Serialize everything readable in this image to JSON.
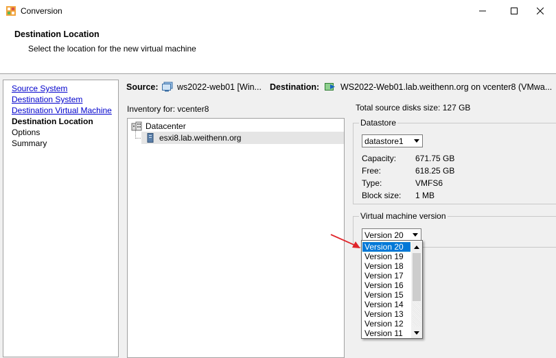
{
  "window": {
    "title": "Conversion",
    "controls": {
      "minimize": "—",
      "maximize": "□",
      "close": "✕"
    }
  },
  "header": {
    "title": "Destination Location",
    "subtitle": "Select the location for the new virtual machine"
  },
  "nav": {
    "items": [
      {
        "label": "Source System",
        "state": "link"
      },
      {
        "label": "Destination System",
        "state": "link"
      },
      {
        "label": "Destination Virtual Machine",
        "state": "link"
      },
      {
        "label": "Destination Location",
        "state": "current"
      },
      {
        "label": "Options",
        "state": "pending"
      },
      {
        "label": "Summary",
        "state": "pending"
      }
    ]
  },
  "source_line": {
    "source_label": "Source:",
    "source_value": "ws2022-web01 [Win...",
    "destination_label": "Destination:",
    "destination_value": "WS2022-Web01.lab.weithenn.org on vcenter8 (VMwa..."
  },
  "inventory": {
    "label": "Inventory for:  vcenter8",
    "tree": [
      {
        "label": "Datacenter",
        "icon": "datacenter-icon",
        "level": 0
      },
      {
        "label": "esxi8.lab.weithenn.org",
        "icon": "host-icon",
        "level": 1,
        "selected": true
      }
    ]
  },
  "details": {
    "total_disks": "Total source disks size:  127 GB",
    "datastore": {
      "title": "Datastore",
      "selected": "datastore1",
      "rows": [
        {
          "key": "Capacity:",
          "value": "671.75 GB"
        },
        {
          "key": "Free:",
          "value": "618.25 GB"
        },
        {
          "key": "Type:",
          "value": "VMFS6"
        },
        {
          "key": "Block size:",
          "value": "1 MB"
        }
      ]
    },
    "vm_version": {
      "title": "Virtual machine version",
      "selected": "Version 20",
      "options": [
        "Version 20",
        "Version 19",
        "Version 18",
        "Version 17",
        "Version 16",
        "Version 15",
        "Version 14",
        "Version 13",
        "Version 12",
        "Version 11"
      ]
    }
  },
  "colors": {
    "link": "#0000cc",
    "selection": "#0078d7",
    "annotation_arrow": "#e0252b"
  }
}
